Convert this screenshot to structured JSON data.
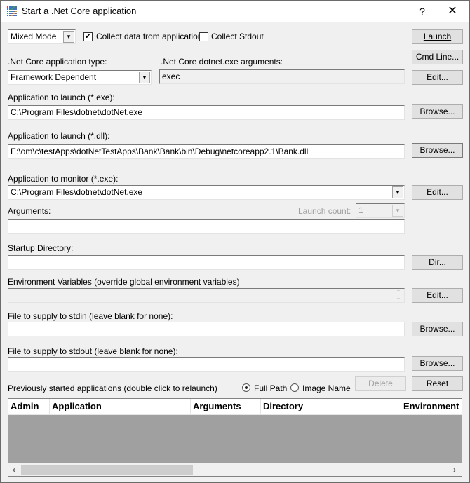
{
  "window": {
    "title": "Start a .Net Core application",
    "help_label": "?",
    "close_label": "✕"
  },
  "top": {
    "mode_select": "Mixed Mode",
    "collect_data_label": "Collect data from application",
    "collect_data_checked": true,
    "collect_stdout_label": "Collect Stdout",
    "collect_stdout_checked": false
  },
  "buttons": {
    "launch": "Launch",
    "cmd_line": "Cmd Line...",
    "edit_args": "Edit...",
    "browse_exe": "Browse...",
    "browse_dll": "Browse...",
    "edit_monitor": "Edit...",
    "dir": "Dir...",
    "edit_env": "Edit...",
    "browse_stdin": "Browse...",
    "browse_stdout": "Browse...",
    "delete": "Delete",
    "reset": "Reset"
  },
  "app_type": {
    "label": ".Net Core application type:",
    "value": "Framework Dependent"
  },
  "dotnet_args": {
    "label": ".Net Core dotnet.exe arguments:",
    "value": "exec"
  },
  "launch_exe": {
    "label": "Application to launch (*.exe):",
    "value": "C:\\Program Files\\dotnet\\dotNet.exe"
  },
  "launch_dll": {
    "label": "Application to launch (*.dll):",
    "value": "E:\\om\\c\\testApps\\dotNetTestApps\\Bank\\Bank\\bin\\Debug\\netcoreapp2.1\\Bank.dll"
  },
  "monitor_exe": {
    "label": "Application to monitor (*.exe):",
    "value": "C:\\Program Files\\dotnet\\dotNet.exe"
  },
  "arguments": {
    "label": "Arguments:",
    "value": "",
    "launch_count_label": "Launch count:",
    "launch_count_value": "1"
  },
  "startup_dir": {
    "label": "Startup Directory:",
    "value": ""
  },
  "env_vars": {
    "label": "Environment Variables (override global environment variables)",
    "value": ""
  },
  "stdin_file": {
    "label": "File to supply to stdin (leave blank for none):",
    "value": ""
  },
  "stdout_file": {
    "label": "File to supply to stdout (leave blank for none):",
    "value": ""
  },
  "history": {
    "label": "Previously started applications (double click to relaunch)",
    "radio_full_path": "Full Path",
    "radio_image_name": "Image Name",
    "selected_radio": "Full Path",
    "columns": [
      "Admin",
      "Application",
      "Arguments",
      "Directory",
      "Environment"
    ],
    "rows": []
  },
  "icons": {
    "app": "grid-icon",
    "help": "question-icon",
    "close": "close-icon",
    "dropdown": "▼",
    "scroll_left": "‹",
    "scroll_right": "›"
  }
}
